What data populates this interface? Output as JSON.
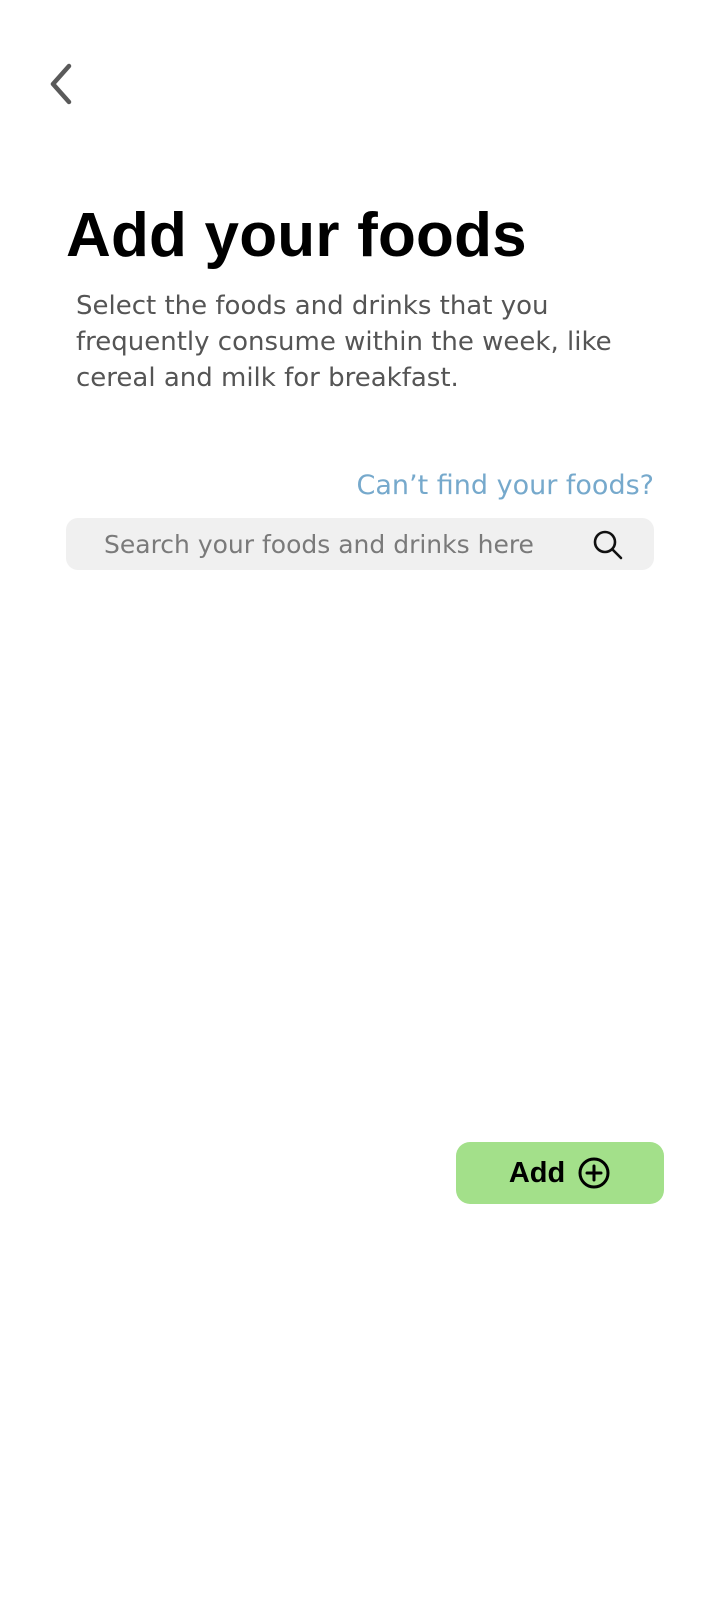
{
  "header": {
    "back_icon": "chevron-left-icon"
  },
  "main": {
    "title": "Add your foods",
    "description": "Select the foods and drinks that you frequently consume within the week, like cereal and milk for breakfast.",
    "help_link": "Can’t find your foods?"
  },
  "search": {
    "placeholder": "Search your foods and drinks here",
    "value": "",
    "icon": "search-icon"
  },
  "actions": {
    "add_label": "Add",
    "add_icon": "plus-circle-icon",
    "add_color": "#a3e08a"
  },
  "colors": {
    "link": "#76a9cc",
    "search_background": "#f0f0f0",
    "description_text": "#555555"
  }
}
